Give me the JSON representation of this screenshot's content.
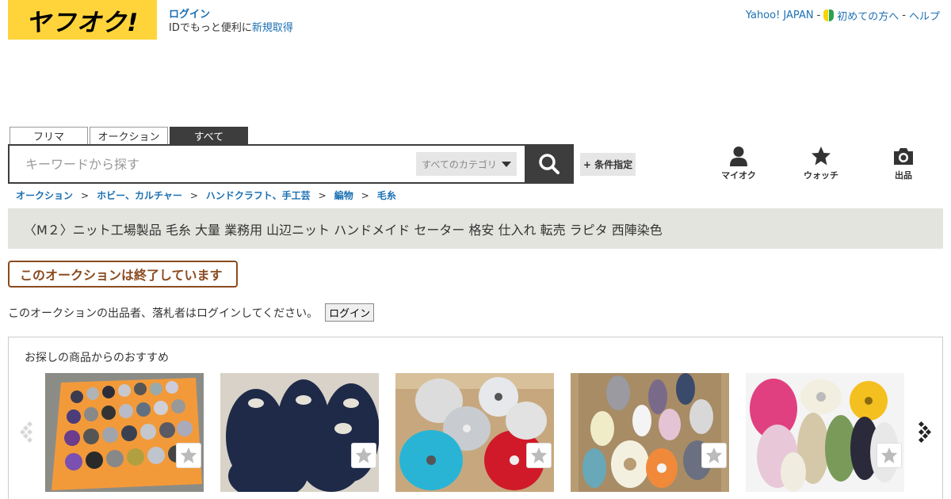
{
  "header": {
    "logo_text": "ヤフオク!",
    "login_label": "ログイン",
    "id_text": "IDでもっと便利に",
    "signup_label": "新規取得",
    "top_links": [
      "Yahoo! JAPAN",
      "初めての方へ",
      "ヘルプ"
    ],
    "separator": "-"
  },
  "search": {
    "tabs": [
      {
        "label": "フリマ",
        "active": false
      },
      {
        "label": "オークション",
        "active": false
      },
      {
        "label": "すべて",
        "active": true
      }
    ],
    "placeholder": "キーワードから探す",
    "category_label": "すべてのカテゴリ",
    "advanced_label": "+ 条件指定"
  },
  "nav": {
    "myauction_label": "マイオク",
    "watch_label": "ウォッチ",
    "sell_label": "出品"
  },
  "breadcrumb": {
    "items": [
      "オークション",
      "ホビー、カルチャー",
      "ハンドクラフト、手工芸",
      "編物",
      "毛糸"
    ],
    "separator": ">"
  },
  "item": {
    "title": "〈M２〉ニット工場製品 毛糸 大量 業務用 山辺ニット ハンドメイド セーター 格安 仕入れ 転売 ラピタ 西陣染色",
    "status": "このオークションは終了しています",
    "login_notice": "このオークションの出品者、落札者はログインしてください。",
    "login_button": "ログイン"
  },
  "recommend": {
    "title": "お探しの商品からのおすすめ",
    "items": [
      {
        "photo": "orange-crate-yarn-cones"
      },
      {
        "photo": "navy-boucle-yarn-cones"
      },
      {
        "photo": "box-of-colored-yarn-cones"
      },
      {
        "photo": "box-of-pastel-yarn-cones"
      },
      {
        "photo": "multicolor-fancy-yarn-cones"
      }
    ]
  },
  "colors": {
    "logo_bg": "#ffd43b",
    "link": "#1b70b3",
    "dark": "#3d3d3d",
    "title_bar_bg": "#e4e4df",
    "ended_badge": "#8a4b1f"
  }
}
